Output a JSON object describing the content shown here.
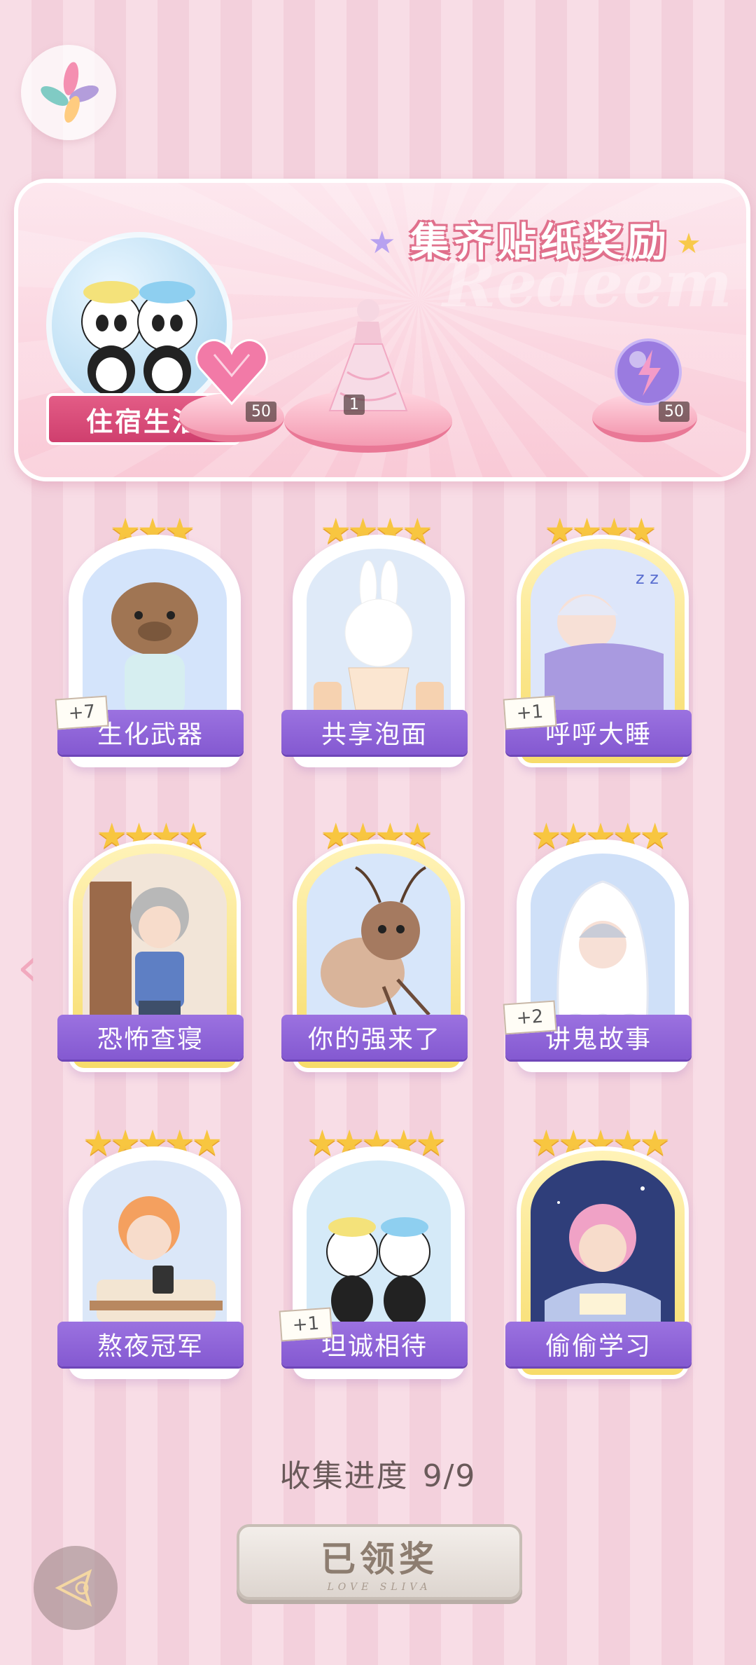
{
  "banner": {
    "title": "集齐贴纸奖励",
    "watermark": "Redeem",
    "theme_label": "住宿生活",
    "rewards": [
      {
        "icon": "heart-gem-icon",
        "count": "50"
      },
      {
        "icon": "pink-gown-icon",
        "count": "1"
      },
      {
        "icon": "lightning-orb-icon",
        "count": "50"
      }
    ]
  },
  "cards": [
    {
      "label": "生化武器",
      "stars": "★★★",
      "badge": "+7"
    },
    {
      "label": "共享泡面",
      "stars": "★★★★",
      "badge": ""
    },
    {
      "label": "呼呼大睡",
      "stars": "★★★★",
      "badge": "+1"
    },
    {
      "label": "恐怖查寝",
      "stars": "★★★★",
      "badge": ""
    },
    {
      "label": "你的强来了",
      "stars": "★★★★",
      "badge": ""
    },
    {
      "label": "讲鬼故事",
      "stars": "★★★★★",
      "badge": "+2"
    },
    {
      "label": "熬夜冠军",
      "stars": "★★★★★",
      "badge": ""
    },
    {
      "label": "坦诚相待",
      "stars": "★★★★★",
      "badge": "+1"
    },
    {
      "label": "偷偷学习",
      "stars": "★★★★★",
      "badge": ""
    }
  ],
  "progress": {
    "label": "收集进度",
    "value": "9/9"
  },
  "claim_button": {
    "label": "已领奖",
    "sub": "LOVE SLIVA"
  },
  "colors": {
    "accent_purple": "#8c62d6",
    "ribbon_pink": "#d9487a",
    "star_gold": "#f8c640"
  }
}
